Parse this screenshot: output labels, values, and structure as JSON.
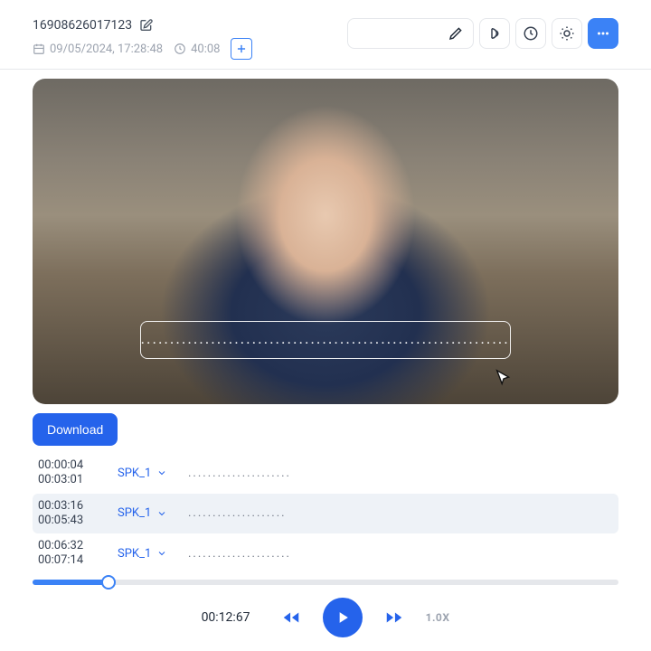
{
  "header": {
    "title": "16908626017123",
    "date": "09/05/2024, 17:28:48",
    "duration": "40:08"
  },
  "caption_dots": "........................................................................",
  "download_label": "Download",
  "transcript": [
    {
      "start": "00:00:04",
      "end": "00:03:01",
      "speaker": "SPK_1",
      "text": "....................."
    },
    {
      "start": "00:03:16",
      "end": "00:05:43",
      "speaker": "SPK_1",
      "text": "...................."
    },
    {
      "start": "00:06:32",
      "end": "00:07:14",
      "speaker": "SPK_1",
      "text": "....................."
    }
  ],
  "player": {
    "current": "00:12:67",
    "speed": "1.0X"
  }
}
